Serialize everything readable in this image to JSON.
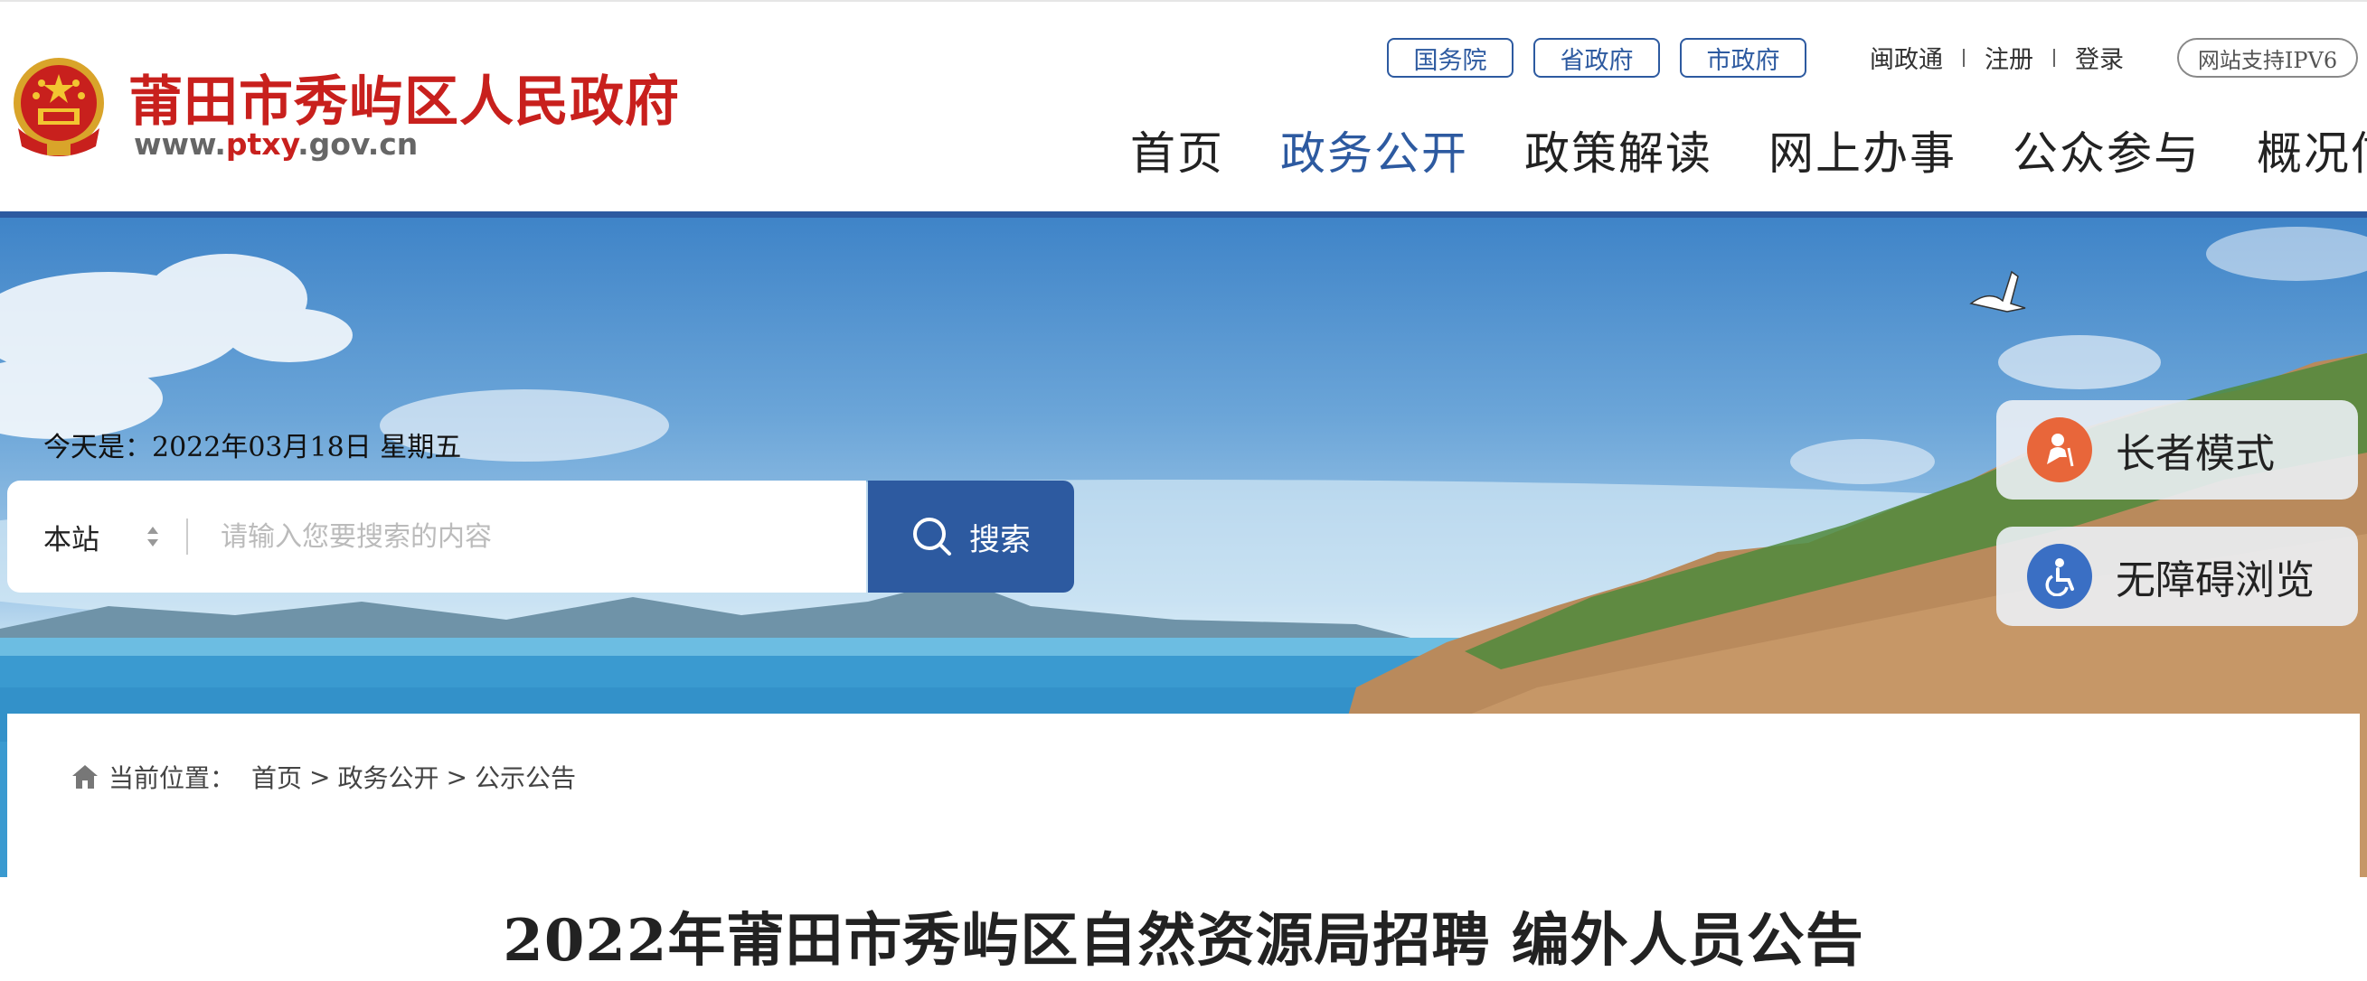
{
  "header": {
    "site_name": "莆田市秀屿区人民政府",
    "site_url_prefix": "www.",
    "site_url_highlight": "ptxy",
    "site_url_suffix": ".gov.cn",
    "gov_links": [
      "国务院",
      "省政府",
      "市政府"
    ],
    "user_links": [
      "闽政通",
      "注册",
      "登录"
    ],
    "ipv6_label": "网站支持IPV6",
    "nav": [
      "首页",
      "政务公开",
      "政策解读",
      "网上办事",
      "公众参与",
      "概况信息"
    ],
    "active_nav": "政务公开"
  },
  "banner": {
    "date_text": "今天是：2022年03月18日 星期五",
    "search": {
      "scope": "本站",
      "placeholder": "请输入您要搜索的内容",
      "button_label": "搜索"
    },
    "side_buttons": {
      "elder_mode": "长者模式",
      "accessible": "无障碍浏览"
    }
  },
  "content": {
    "breadcrumb": {
      "label": "当前位置：",
      "items": [
        "首页",
        "政务公开",
        "公示公告"
      ],
      "separator": ">"
    },
    "title": "2022年莆田市秀屿区自然资源局招聘 编外人员公告"
  },
  "colors": {
    "brand_blue": "#2d5aa0",
    "brand_red": "#c8201d",
    "elder_orange": "#e8663a",
    "accessible_blue": "#3a6fc4"
  },
  "icons": [
    "national-emblem-icon",
    "search-icon",
    "elder-icon",
    "wheelchair-icon",
    "home-icon"
  ]
}
